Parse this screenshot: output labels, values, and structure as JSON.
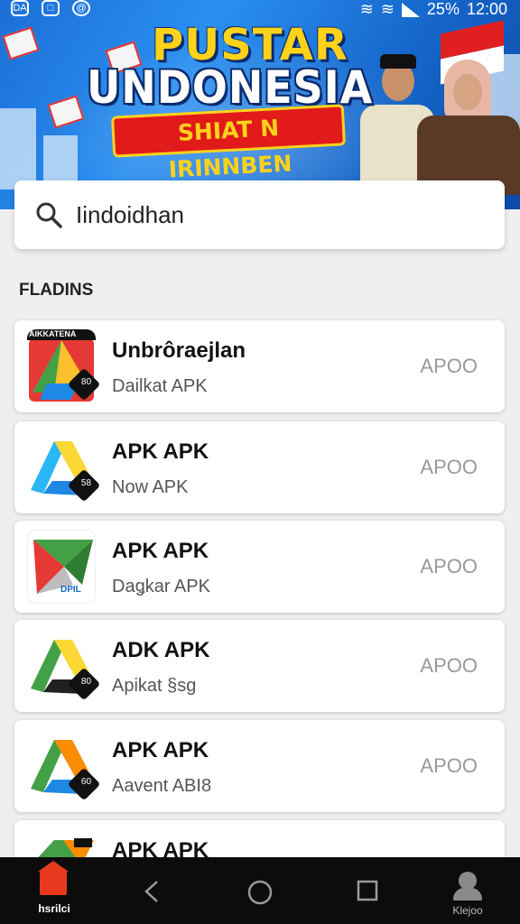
{
  "status_bar": {
    "time": "12:00",
    "battery": "25%"
  },
  "banner": {
    "title_line1": "PUSTAR",
    "title_line2": "UNDONESIA",
    "ribbon_text": "SHIAT N IRINNBEN"
  },
  "search": {
    "value": "Iindoidhan",
    "icon": "search-icon"
  },
  "section_title": "FLADINS",
  "apps": [
    {
      "name": "Unbrôraejlan",
      "sub": "Dailkat APK",
      "price": "APOO",
      "icon_label": "AIKKATENA",
      "badge": "80"
    },
    {
      "name": "APK APK",
      "sub": "Now APK",
      "price": "APOO",
      "badge": "58"
    },
    {
      "name": "APK APK",
      "sub": "Daǥkar APK",
      "price": "APOO",
      "icon_label": "DPIL"
    },
    {
      "name": "ADK APK",
      "sub": "Apikat §sg",
      "price": "APOO",
      "badge": "80"
    },
    {
      "name": "APK  APK",
      "sub": "Aavent ABI8",
      "price": "APOO",
      "badge": "60"
    },
    {
      "name": "APK APK",
      "sub": "",
      "price": ""
    }
  ],
  "navbar": {
    "home_label": "hsrilci",
    "profile_label": "Klejoo"
  },
  "colors": {
    "accent": "#e8391f",
    "banner_blue": "#1b6fd6",
    "gold": "#ffd21a"
  }
}
